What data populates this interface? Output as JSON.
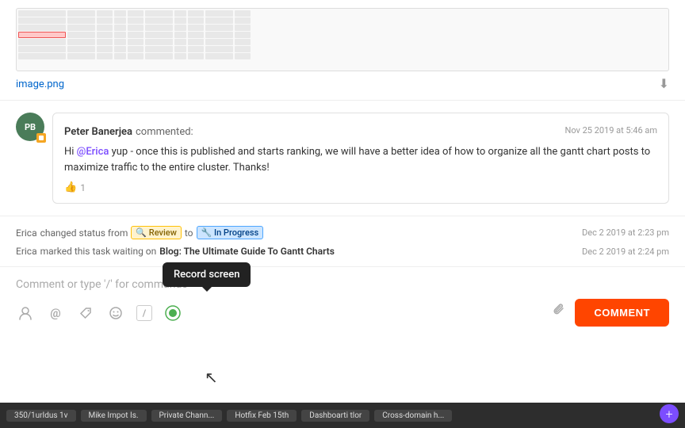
{
  "image": {
    "filename": "image.png",
    "download_icon": "⬇"
  },
  "comment": {
    "author": "Peter Banerjea",
    "action": "commented:",
    "timestamp": "Nov 25 2019 at 5:46 am",
    "avatar_initials": "PB",
    "mention": "@Erica",
    "text_before": "Hi ",
    "text_after": " yup - once this is published and starts ranking, we will have a better idea of how to organize all the gantt chart posts to maximize traffic to the entire cluster. Thanks!",
    "likes": "1"
  },
  "status_changes": [
    {
      "author": "Erica",
      "action": "changed status from",
      "from_badge": "Review",
      "to_text": "to",
      "to_badge": "In Progress",
      "timestamp": "Dec 2 2019 at 2:23 pm"
    },
    {
      "author": "Erica",
      "action": "marked this task waiting on",
      "link": "Blog: The Ultimate Guide To Gantt Charts",
      "timestamp": "Dec 2 2019 at 2:24 pm"
    }
  ],
  "comment_input": {
    "placeholder": "Comment or type '/' for commands",
    "button_label": "COMMENT"
  },
  "toolbar": {
    "icons": [
      {
        "name": "mention-icon",
        "symbol": "☺",
        "label": "mention"
      },
      {
        "name": "at-icon",
        "symbol": "@",
        "label": "at"
      },
      {
        "name": "emoji-icon",
        "symbol": "☻",
        "label": "emoji"
      },
      {
        "name": "smile-icon",
        "symbol": "😊",
        "label": "smile"
      },
      {
        "name": "slash-icon",
        "symbol": "/",
        "label": "slash"
      },
      {
        "name": "record-icon",
        "symbol": "⏺",
        "label": "record",
        "active": true
      }
    ],
    "attach_icon": "📎"
  },
  "tooltip": {
    "text": "Record screen"
  },
  "taskbar": {
    "items": [
      "350/1urIdus 1v",
      "Mike Impot Is.",
      "Private Chann...",
      "Hotfix Feb 15th",
      "Dashboarti tlor",
      "Cross-domain h..."
    ],
    "fab_icon": "+"
  }
}
